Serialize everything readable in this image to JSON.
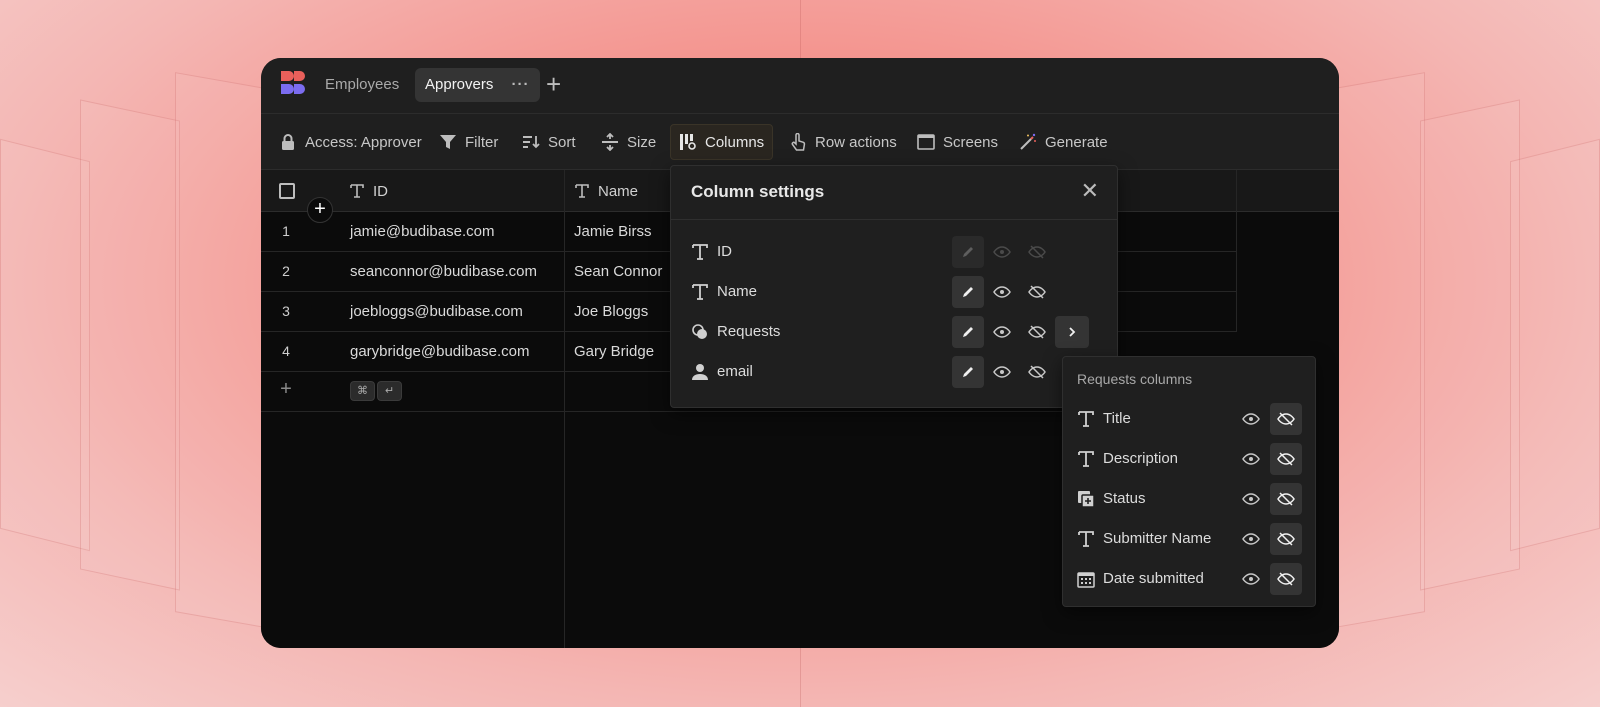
{
  "tabs": [
    {
      "label": "Employees",
      "active": false
    },
    {
      "label": "Approvers",
      "active": true
    }
  ],
  "tab_more": "···",
  "add_tab": "+",
  "toolbar": {
    "access": "Access: Approver",
    "filter": "Filter",
    "sort": "Sort",
    "size": "Size",
    "columns": "Columns",
    "row_actions": "Row actions",
    "screens": "Screens",
    "generate": "Generate"
  },
  "grid": {
    "columns": [
      {
        "label": "ID",
        "icon": "text-type-icon"
      },
      {
        "label": "Name",
        "icon": "text-type-icon"
      }
    ],
    "rows": [
      {
        "num": "1",
        "id": "jamie@budibase.com",
        "name": "Jamie Birss"
      },
      {
        "num": "2",
        "id": "seanconnor@budibase.com",
        "name": "Sean Connor"
      },
      {
        "num": "3",
        "id": "joebloggs@budibase.com",
        "name": "Joe Bloggs"
      },
      {
        "num": "4",
        "id": "garybridge@budibase.com",
        "name": "Gary Bridge"
      }
    ],
    "add_row": "+",
    "shortcut_cmd": "⌘",
    "shortcut_enter": "↵"
  },
  "column_settings": {
    "title": "Column settings",
    "close": "✕",
    "items": [
      {
        "label": "ID",
        "icon": "text-type-icon",
        "disabled": true
      },
      {
        "label": "Name",
        "icon": "text-type-icon",
        "disabled": false
      },
      {
        "label": "Requests",
        "icon": "relationship-icon",
        "disabled": false
      },
      {
        "label": "email",
        "icon": "user-icon",
        "disabled": false
      }
    ]
  },
  "requests_columns": {
    "title": "Requests columns",
    "items": [
      {
        "label": "Title",
        "icon": "text-type-icon"
      },
      {
        "label": "Description",
        "icon": "text-type-icon"
      },
      {
        "label": "Status",
        "icon": "options-icon"
      },
      {
        "label": "Submitter Name",
        "icon": "text-type-icon"
      },
      {
        "label": "Date submitted",
        "icon": "calendar-icon"
      }
    ]
  },
  "colors": {
    "background": "#f4928c",
    "app": "#0b0b0b",
    "panel": "#1f1f1f",
    "logo_red": "#e9605b",
    "logo_purple": "#7b6cf0"
  }
}
